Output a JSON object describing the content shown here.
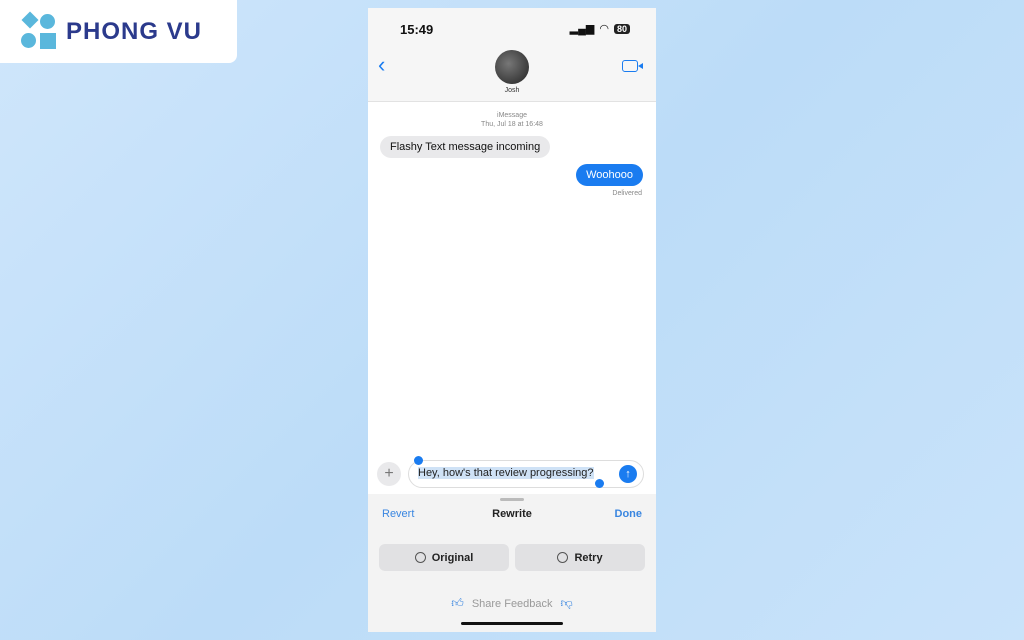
{
  "logo": {
    "text": "PHONG VU"
  },
  "status": {
    "time": "15:49",
    "battery": "80"
  },
  "header": {
    "contact": "Josh",
    "back_icon": "chevron-left-icon",
    "video_icon": "video-camera-icon"
  },
  "thread": {
    "service": "iMessage",
    "date": "Thu, Jul 18 at 16:48",
    "messages": [
      {
        "from": "them",
        "text": "Flashy Text message incoming"
      },
      {
        "from": "me",
        "text": "Woohooo"
      }
    ],
    "receipt": "Delivered"
  },
  "composer": {
    "text": "Hey, how's that review progressing?",
    "plus": "+",
    "send": "↑"
  },
  "rewrite": {
    "revert": "Revert",
    "title": "Rewrite",
    "done": "Done",
    "original": "Original",
    "retry": "Retry",
    "feedback": "Share Feedback"
  },
  "colors": {
    "accent": "#1a7cf0",
    "brand": "#2b3a8c"
  }
}
